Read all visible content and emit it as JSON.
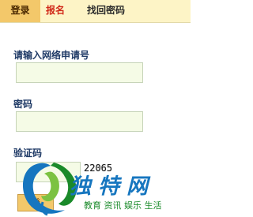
{
  "tabs": {
    "login": "登录",
    "register": "报名",
    "recover_password": "找回密码"
  },
  "form": {
    "application_number_label": "请输入网络申请号",
    "application_number_value": "",
    "password_label": "密码",
    "password_value": "",
    "captcha_label": "验证码",
    "captcha_value": "",
    "captcha_code": "22065",
    "login_button": "登"
  },
  "watermark": {
    "name": "独特网",
    "tagline": "教育 资讯 娱乐 生活"
  },
  "colors": {
    "tab_bar": "#fdf4c6",
    "active_tab": "#f3c86a",
    "register_tab_text": "#d12a1a",
    "label_text": "#1f3a66",
    "input_background": "#f5fbe6",
    "watermark_blue": "#1676bf",
    "watermark_green": "#1a8a2a"
  }
}
